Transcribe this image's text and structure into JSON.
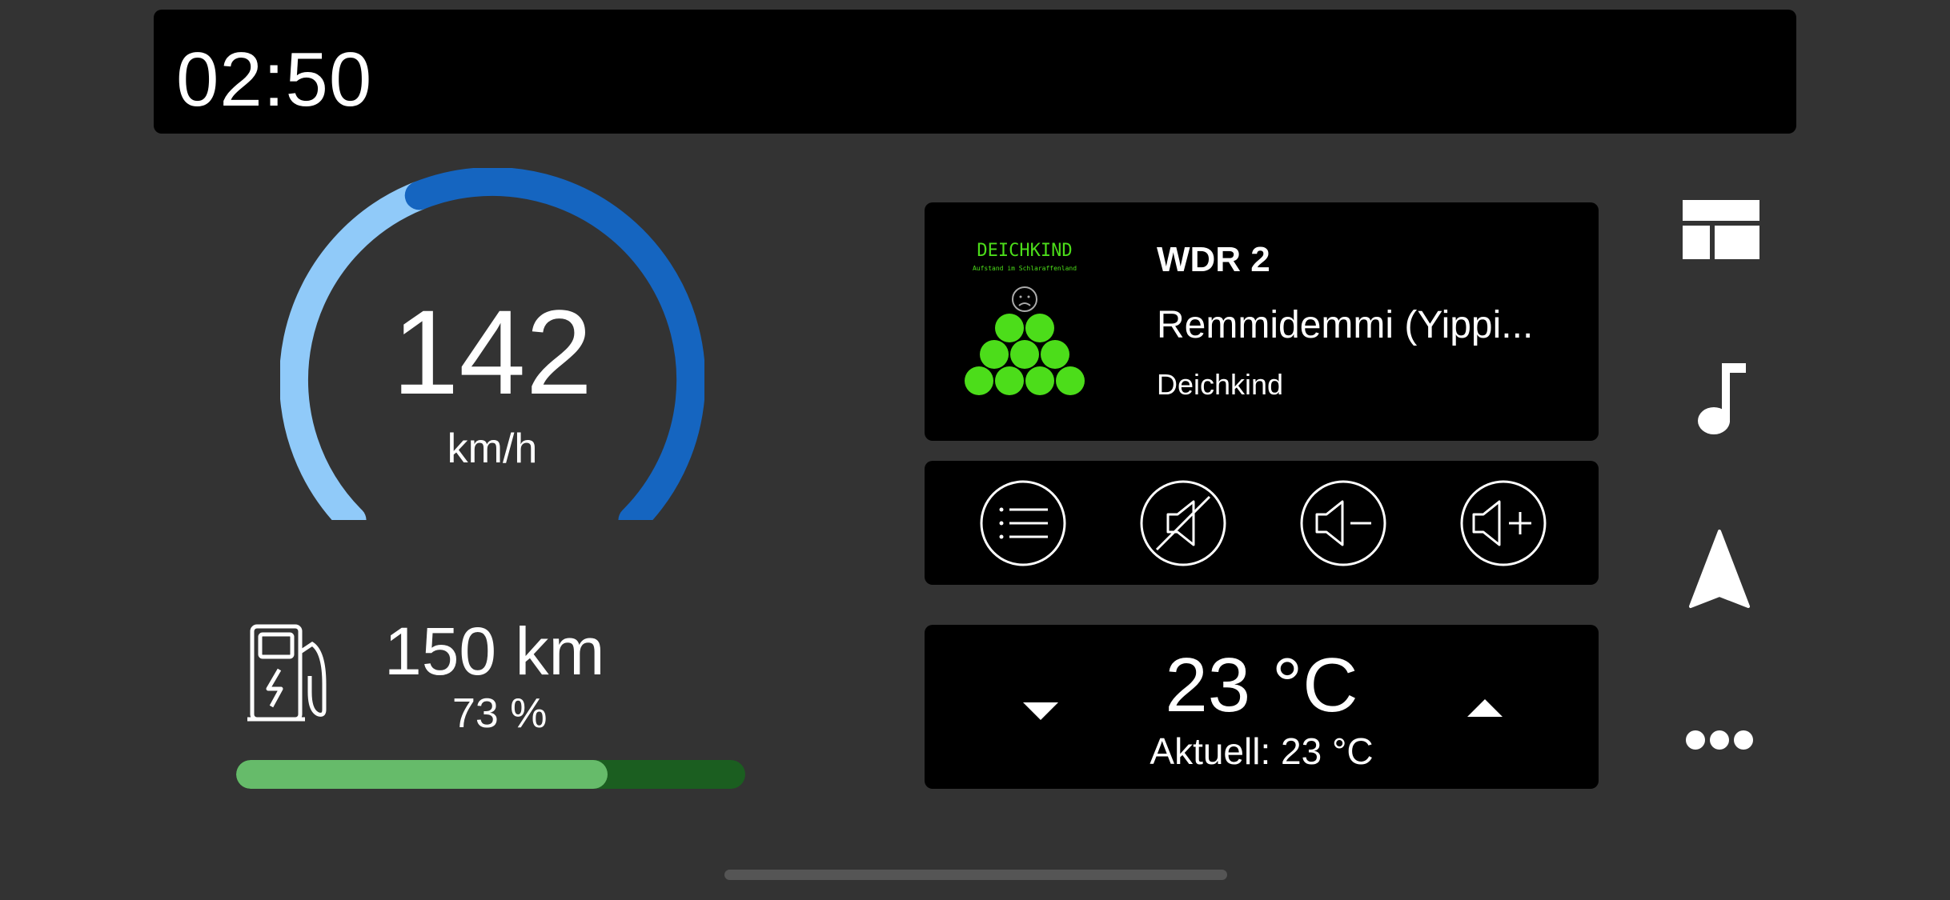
{
  "status_bar": {
    "time": "02:50"
  },
  "speedometer": {
    "speed": "142",
    "unit": "km/h",
    "speed_fraction": 0.42
  },
  "battery": {
    "range": "150 km",
    "percent": "73 %",
    "level": 0.73
  },
  "media": {
    "station": "WDR 2",
    "track": "Remmidemmi (Yippi...",
    "artist": "Deichkind",
    "album_art_text": "DEICHKIND",
    "album_art_subtitle": "Aufstand im Schlaraffenland"
  },
  "media_controls": {
    "buttons": [
      "list-icon",
      "mute-icon",
      "volume-down-icon",
      "volume-up-icon"
    ]
  },
  "climate": {
    "set_temp": "23 °C",
    "current_temp": "Aktuell: 23 °C"
  },
  "nav": {
    "items": [
      "dashboard-icon",
      "music-note-icon",
      "navigation-arrow-icon",
      "more-icon"
    ]
  },
  "colors": {
    "background": "#333333",
    "panel": "#000000",
    "gauge_light": "#90caf9",
    "gauge_dark": "#1565c0",
    "battery_fill": "#66bb6a",
    "battery_track": "#1b5e20",
    "album_green": "#4cdd1a"
  }
}
